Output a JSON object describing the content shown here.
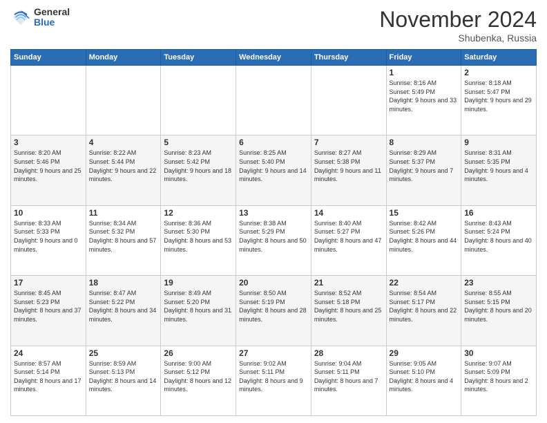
{
  "logo": {
    "general": "General",
    "blue": "Blue"
  },
  "header": {
    "month": "November 2024",
    "location": "Shubenka, Russia"
  },
  "weekdays": [
    "Sunday",
    "Monday",
    "Tuesday",
    "Wednesday",
    "Thursday",
    "Friday",
    "Saturday"
  ],
  "weeks": [
    [
      {
        "day": "",
        "text": ""
      },
      {
        "day": "",
        "text": ""
      },
      {
        "day": "",
        "text": ""
      },
      {
        "day": "",
        "text": ""
      },
      {
        "day": "",
        "text": ""
      },
      {
        "day": "1",
        "text": "Sunrise: 8:16 AM\nSunset: 5:49 PM\nDaylight: 9 hours and 33 minutes."
      },
      {
        "day": "2",
        "text": "Sunrise: 8:18 AM\nSunset: 5:47 PM\nDaylight: 9 hours and 29 minutes."
      }
    ],
    [
      {
        "day": "3",
        "text": "Sunrise: 8:20 AM\nSunset: 5:46 PM\nDaylight: 9 hours and 25 minutes."
      },
      {
        "day": "4",
        "text": "Sunrise: 8:22 AM\nSunset: 5:44 PM\nDaylight: 9 hours and 22 minutes."
      },
      {
        "day": "5",
        "text": "Sunrise: 8:23 AM\nSunset: 5:42 PM\nDaylight: 9 hours and 18 minutes."
      },
      {
        "day": "6",
        "text": "Sunrise: 8:25 AM\nSunset: 5:40 PM\nDaylight: 9 hours and 14 minutes."
      },
      {
        "day": "7",
        "text": "Sunrise: 8:27 AM\nSunset: 5:38 PM\nDaylight: 9 hours and 11 minutes."
      },
      {
        "day": "8",
        "text": "Sunrise: 8:29 AM\nSunset: 5:37 PM\nDaylight: 9 hours and 7 minutes."
      },
      {
        "day": "9",
        "text": "Sunrise: 8:31 AM\nSunset: 5:35 PM\nDaylight: 9 hours and 4 minutes."
      }
    ],
    [
      {
        "day": "10",
        "text": "Sunrise: 8:33 AM\nSunset: 5:33 PM\nDaylight: 9 hours and 0 minutes."
      },
      {
        "day": "11",
        "text": "Sunrise: 8:34 AM\nSunset: 5:32 PM\nDaylight: 8 hours and 57 minutes."
      },
      {
        "day": "12",
        "text": "Sunrise: 8:36 AM\nSunset: 5:30 PM\nDaylight: 8 hours and 53 minutes."
      },
      {
        "day": "13",
        "text": "Sunrise: 8:38 AM\nSunset: 5:29 PM\nDaylight: 8 hours and 50 minutes."
      },
      {
        "day": "14",
        "text": "Sunrise: 8:40 AM\nSunset: 5:27 PM\nDaylight: 8 hours and 47 minutes."
      },
      {
        "day": "15",
        "text": "Sunrise: 8:42 AM\nSunset: 5:26 PM\nDaylight: 8 hours and 44 minutes."
      },
      {
        "day": "16",
        "text": "Sunrise: 8:43 AM\nSunset: 5:24 PM\nDaylight: 8 hours and 40 minutes."
      }
    ],
    [
      {
        "day": "17",
        "text": "Sunrise: 8:45 AM\nSunset: 5:23 PM\nDaylight: 8 hours and 37 minutes."
      },
      {
        "day": "18",
        "text": "Sunrise: 8:47 AM\nSunset: 5:22 PM\nDaylight: 8 hours and 34 minutes."
      },
      {
        "day": "19",
        "text": "Sunrise: 8:49 AM\nSunset: 5:20 PM\nDaylight: 8 hours and 31 minutes."
      },
      {
        "day": "20",
        "text": "Sunrise: 8:50 AM\nSunset: 5:19 PM\nDaylight: 8 hours and 28 minutes."
      },
      {
        "day": "21",
        "text": "Sunrise: 8:52 AM\nSunset: 5:18 PM\nDaylight: 8 hours and 25 minutes."
      },
      {
        "day": "22",
        "text": "Sunrise: 8:54 AM\nSunset: 5:17 PM\nDaylight: 8 hours and 22 minutes."
      },
      {
        "day": "23",
        "text": "Sunrise: 8:55 AM\nSunset: 5:15 PM\nDaylight: 8 hours and 20 minutes."
      }
    ],
    [
      {
        "day": "24",
        "text": "Sunrise: 8:57 AM\nSunset: 5:14 PM\nDaylight: 8 hours and 17 minutes."
      },
      {
        "day": "25",
        "text": "Sunrise: 8:59 AM\nSunset: 5:13 PM\nDaylight: 8 hours and 14 minutes."
      },
      {
        "day": "26",
        "text": "Sunrise: 9:00 AM\nSunset: 5:12 PM\nDaylight: 8 hours and 12 minutes."
      },
      {
        "day": "27",
        "text": "Sunrise: 9:02 AM\nSunset: 5:11 PM\nDaylight: 8 hours and 9 minutes."
      },
      {
        "day": "28",
        "text": "Sunrise: 9:04 AM\nSunset: 5:11 PM\nDaylight: 8 hours and 7 minutes."
      },
      {
        "day": "29",
        "text": "Sunrise: 9:05 AM\nSunset: 5:10 PM\nDaylight: 8 hours and 4 minutes."
      },
      {
        "day": "30",
        "text": "Sunrise: 9:07 AM\nSunset: 5:09 PM\nDaylight: 8 hours and 2 minutes."
      }
    ]
  ]
}
